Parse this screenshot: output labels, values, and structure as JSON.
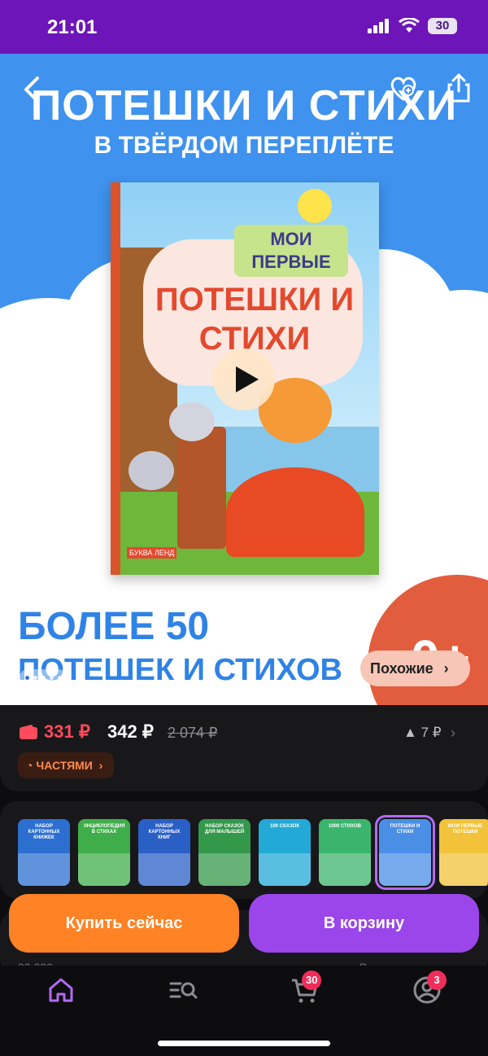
{
  "status_bar": {
    "time": "21:01",
    "battery": "30"
  },
  "hero": {
    "title": "ПОТЕШКИ И СТИХИ",
    "subtitle": "В ТВЁРДОМ ПЕРЕПЛЁТЕ",
    "bottom_line1": "БОЛЕЕ 50",
    "bottom_line2": "ПОТЕШЕК И СТИХОВ",
    "age_badge": "0+",
    "book": {
      "label_top": "МОИ ПЕРВЫЕ",
      "label_title": "ПОТЕШКИ И СТИХИ",
      "brand": "БУКВА ЛЕНД"
    },
    "similar_label": "Похожие",
    "carousel_dots": 5
  },
  "price": {
    "card_price": "331 ₽",
    "price": "342 ₽",
    "old_price": "2 074 ₽",
    "change": "7 ₽",
    "installments_label": "ЧАСТЯМИ"
  },
  "variants": [
    {
      "title": "НАБОР КАРТОННЫХ КНИЖЕК",
      "color": "#2c6fd0"
    },
    {
      "title": "ЭНЦИКЛОПЕДИЯ В СТИХАХ",
      "color": "#3fae4a"
    },
    {
      "title": "НАБОР КАРТОННЫХ КНИГ",
      "color": "#2a5fc6"
    },
    {
      "title": "НАБОР СКАЗОК ДЛЯ МАЛЫШЕЙ",
      "color": "#33984a"
    },
    {
      "title": "100 СКАЗОК",
      "color": "#23a9d6"
    },
    {
      "title": "1000 СТИХОВ",
      "color": "#3bb56d"
    },
    {
      "title": "ПОТЕШКИ И СТИХИ",
      "color": "#4a8ee6",
      "selected": true
    },
    {
      "title": "МОИ ПЕРВЫЕ ПОТЕШКИ",
      "color": "#f2c23a"
    }
  ],
  "actions": {
    "buy_now": "Купить сейчас",
    "add_to_cart": "В корзину"
  },
  "under_row": {
    "left_text": "00 000",
    "right_text": "В"
  },
  "tab_bar": {
    "items": [
      {
        "name": "home",
        "icon": "home-icon"
      },
      {
        "name": "catalog",
        "icon": "search-list-icon"
      },
      {
        "name": "cart",
        "icon": "cart-icon",
        "badge": "30"
      },
      {
        "name": "profile",
        "icon": "profile-icon",
        "badge": "3"
      }
    ]
  },
  "colors": {
    "accent_purple": "#9a46ea",
    "accent_orange": "#ff8225",
    "status_purple": "#6d15b8",
    "price_red": "#ff4b5c"
  }
}
